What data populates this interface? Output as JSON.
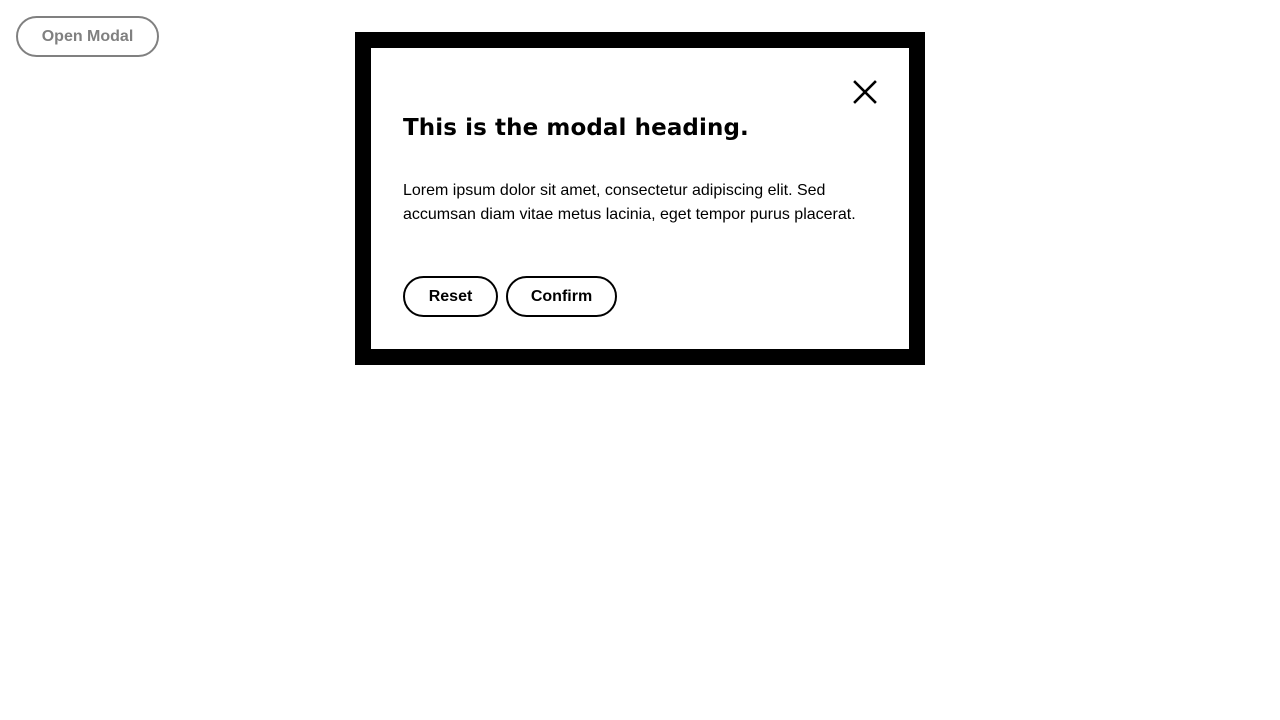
{
  "trigger": {
    "open_modal_label": "Open Modal"
  },
  "modal": {
    "close_icon": "close-icon",
    "heading": "This is the modal heading.",
    "body": "Lorem ipsum dolor sit amet, consectetur adipiscing elit. Sed accumsan diam vitae metus lacinia, eget tempor purus placerat.",
    "actions": {
      "reset_label": "Reset",
      "confirm_label": "Confirm"
    }
  },
  "colors": {
    "background": "#ffffff",
    "modal_border": "#000000",
    "text": "#000000",
    "disabled_trigger": "#808080"
  }
}
